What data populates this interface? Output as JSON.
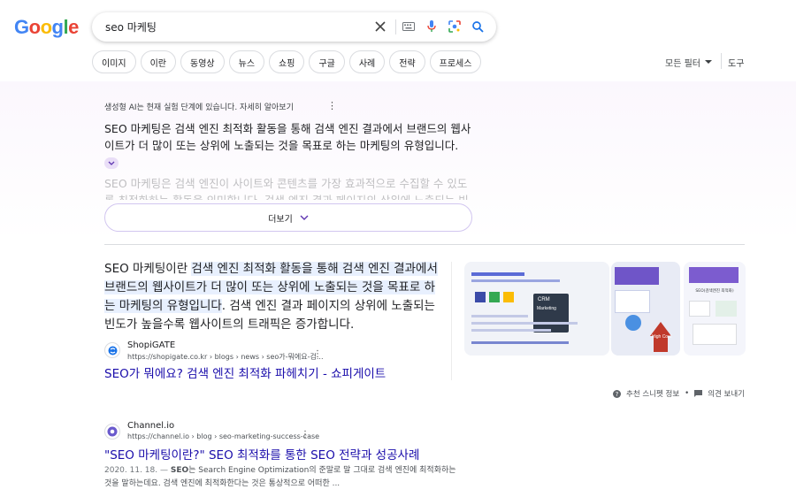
{
  "logo": {
    "g1": "G",
    "o1": "o",
    "o2": "o",
    "g2": "g",
    "l": "l",
    "e": "e"
  },
  "search": {
    "query": "seo 마케팅"
  },
  "chips": [
    "이미지",
    "이란",
    "동영상",
    "뉴스",
    "쇼핑",
    "구글",
    "사례",
    "전략",
    "프로세스"
  ],
  "toolbar": {
    "all_filters": "모든 필터",
    "tools": "도구"
  },
  "ai_overview": {
    "label": "생성형 AI는 현재 실험 단계에 있습니다. 자세히 알아보기",
    "main_text": "SEO 마케팅은 검색 엔진 최적화 활동을 통해 검색 엔진 결과에서 브랜드의 웹사이트가 더 많이 또는 상위에 노출되는 것을 목표로 하는 마케팅의 유형입니다.",
    "faded_text": "SEO 마케팅은 검색 엔진이 사이트와 콘텐츠를 가장 효과적으로 수집할 수 있도록 최적화하는 활동을 의미합니다. 검색 엔진 결과 페이지의 상위에 노출되는 빈",
    "more_label": "더보기"
  },
  "featured_snippet": {
    "text_plain": "SEO 마케팅이란 ",
    "text_highlight": "검색 엔진 최적화 활동을 통해 검색 엔진 결과에서 브랜드의 웹사이트가 더 많이 또는 상위에 노출되는 것을 목표로 하는 마케팅의 유형입니다",
    "text_rest": ". 검색 엔진 결과 페이지의 상위에 노출되는 빈도가 높을수록 웹사이트의 트래픽은 증가합니다.",
    "source_name": "ShopiGATE",
    "source_url": "https://shopigate.co.kr › blogs › news › seo가-뭐에요-검...",
    "title": "SEO가 뭐에요? 검색 엔진 최적화 파헤치기 - 쇼피게이트",
    "meta_about": "추천 스니펫 정보",
    "meta_feedback": "의견 보내기",
    "img_labels": {
      "crm": "CRM",
      "marketing": "Marketing",
      "high_cost": "High Cost",
      "seo_label": "SEO(검색엔진 최적화)"
    }
  },
  "result2": {
    "source_name": "Channel.io",
    "source_url": "https://channel.io › blog › seo-marketing-success-case",
    "title": "\"SEO 마케팅이란?\" SEO 최적화를 통한 SEO 전략과 성공사례",
    "date": "2020. 11. 18. —",
    "snippet_bold": "SEO",
    "snippet": "는 Search Engine Optimization의 준말로 말 그대로 검색 엔진에 최적화하는 것을 말하는데요. 검색 엔진에 최적화한다는 것은 통상적으로 어떠한 ..."
  },
  "colors": {
    "link": "#1a0dab",
    "highlight": "#e8f0fe",
    "ai_border": "#d2c6f0"
  }
}
